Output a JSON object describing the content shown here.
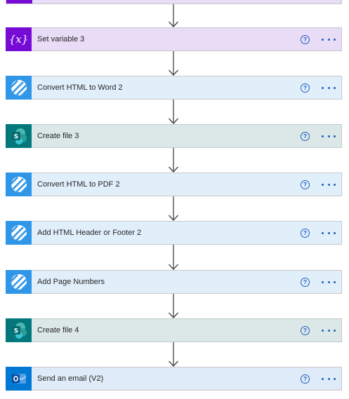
{
  "steps": [
    {
      "id": "set-variable-3",
      "title": "Set variable 3",
      "type": "variable",
      "icon": "variable-icon"
    },
    {
      "id": "convert-html-to-word-2",
      "title": "Convert HTML to Word 2",
      "type": "encodian",
      "icon": "encodian-icon"
    },
    {
      "id": "create-file-3",
      "title": "Create file 3",
      "type": "sharepoint",
      "icon": "sharepoint-icon"
    },
    {
      "id": "convert-html-to-pdf-2",
      "title": "Convert HTML to PDF 2",
      "type": "encodian",
      "icon": "encodian-icon"
    },
    {
      "id": "add-html-header-or-footer-2",
      "title": "Add HTML Header or Footer 2",
      "type": "encodian",
      "icon": "encodian-icon"
    },
    {
      "id": "add-page-numbers",
      "title": "Add Page Numbers",
      "type": "encodian",
      "icon": "encodian-icon"
    },
    {
      "id": "create-file-4",
      "title": "Create file 4",
      "type": "sharepoint",
      "icon": "sharepoint-icon"
    },
    {
      "id": "send-an-email-v2",
      "title": "Send an email (V2)",
      "type": "outlook",
      "icon": "outlook-icon"
    }
  ],
  "help_glyph": "?",
  "colors": {
    "variable_bg": "#e8dcf6",
    "variable_icon": "#770bd6",
    "encodian_bg": "#e1effb",
    "encodian_icon": "#3096e8",
    "sharepoint_bg": "#dbe8e7",
    "sharepoint_icon": "#03787c",
    "outlook_bg": "#dfebf8",
    "outlook_icon": "#0078d4",
    "accent": "#1f5fbf"
  }
}
